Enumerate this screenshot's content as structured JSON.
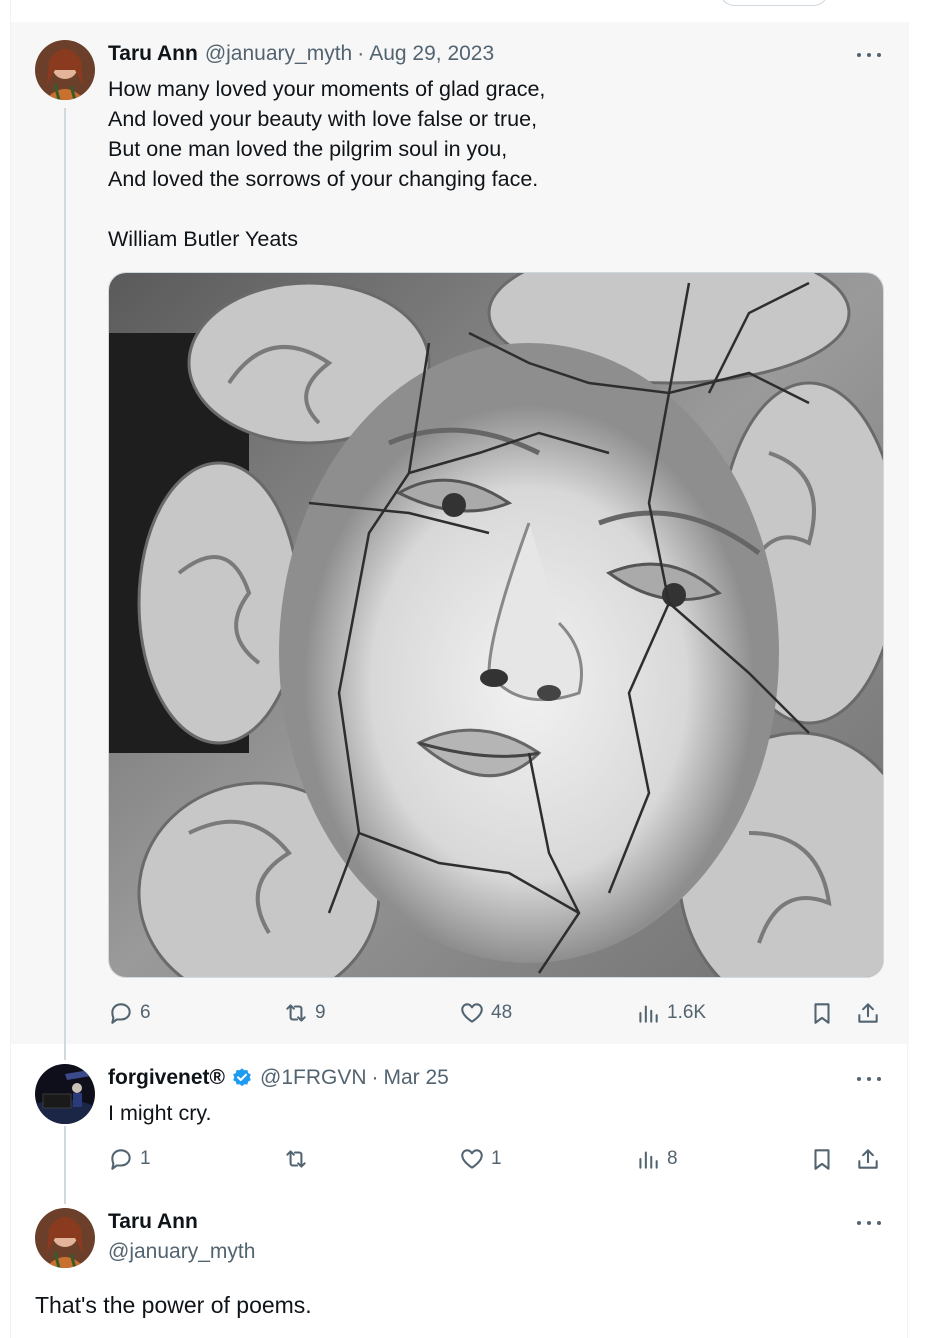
{
  "colors": {
    "accent": "#1d9bf0",
    "muted": "#536471",
    "text": "#0f1419",
    "line": "#cfd9de"
  },
  "main_tweet": {
    "name": "Taru Ann",
    "handle": "@january_myth",
    "separator": "·",
    "date": "Aug 29, 2023",
    "text": "How many loved your moments of glad grace,\nAnd loved your beauty with love false or true,\nBut one man loved the pilgrim soul in you,\nAnd loved the sorrows of your changing face.\n\nWilliam Butler Yeats",
    "media_icon": "cracked-statue-face-image",
    "actions": {
      "replies": "6",
      "reposts": "9",
      "likes": "48",
      "views": "1.6K"
    }
  },
  "reply_1": {
    "name": "forgivenet®",
    "verified": true,
    "handle": "@1FRGVN",
    "separator": "·",
    "date": "Mar 25",
    "text": "I might cry.",
    "actions": {
      "replies": "1",
      "reposts": "",
      "likes": "1",
      "views": "8"
    }
  },
  "reply_2": {
    "name": "Taru Ann",
    "handle": "@january_myth",
    "text": "That's the power of poems."
  }
}
